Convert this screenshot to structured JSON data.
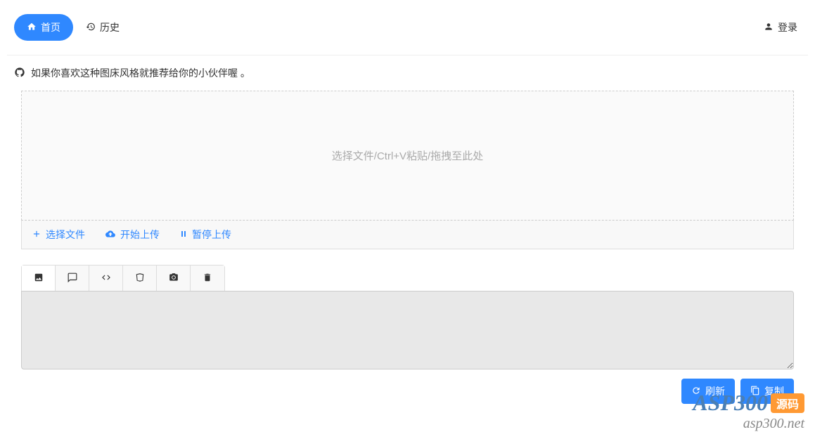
{
  "nav": {
    "home_label": "首页",
    "history_label": "历史",
    "login_label": "登录"
  },
  "promo": {
    "text": "如果你喜欢这种图床风格就推荐给你的小伙伴喔 。"
  },
  "upload": {
    "dropzone_hint": "选择文件/Ctrl+V粘贴/拖拽至此处",
    "select_file_label": "选择文件",
    "start_upload_label": "开始上传",
    "pause_upload_label": "暂停上传"
  },
  "output": {
    "textarea_value": ""
  },
  "actions": {
    "refresh_label": "刷新",
    "copy_label": "复制"
  },
  "watermark": {
    "top": "ASP300",
    "badge": "源码",
    "bottom": "asp300.net"
  }
}
